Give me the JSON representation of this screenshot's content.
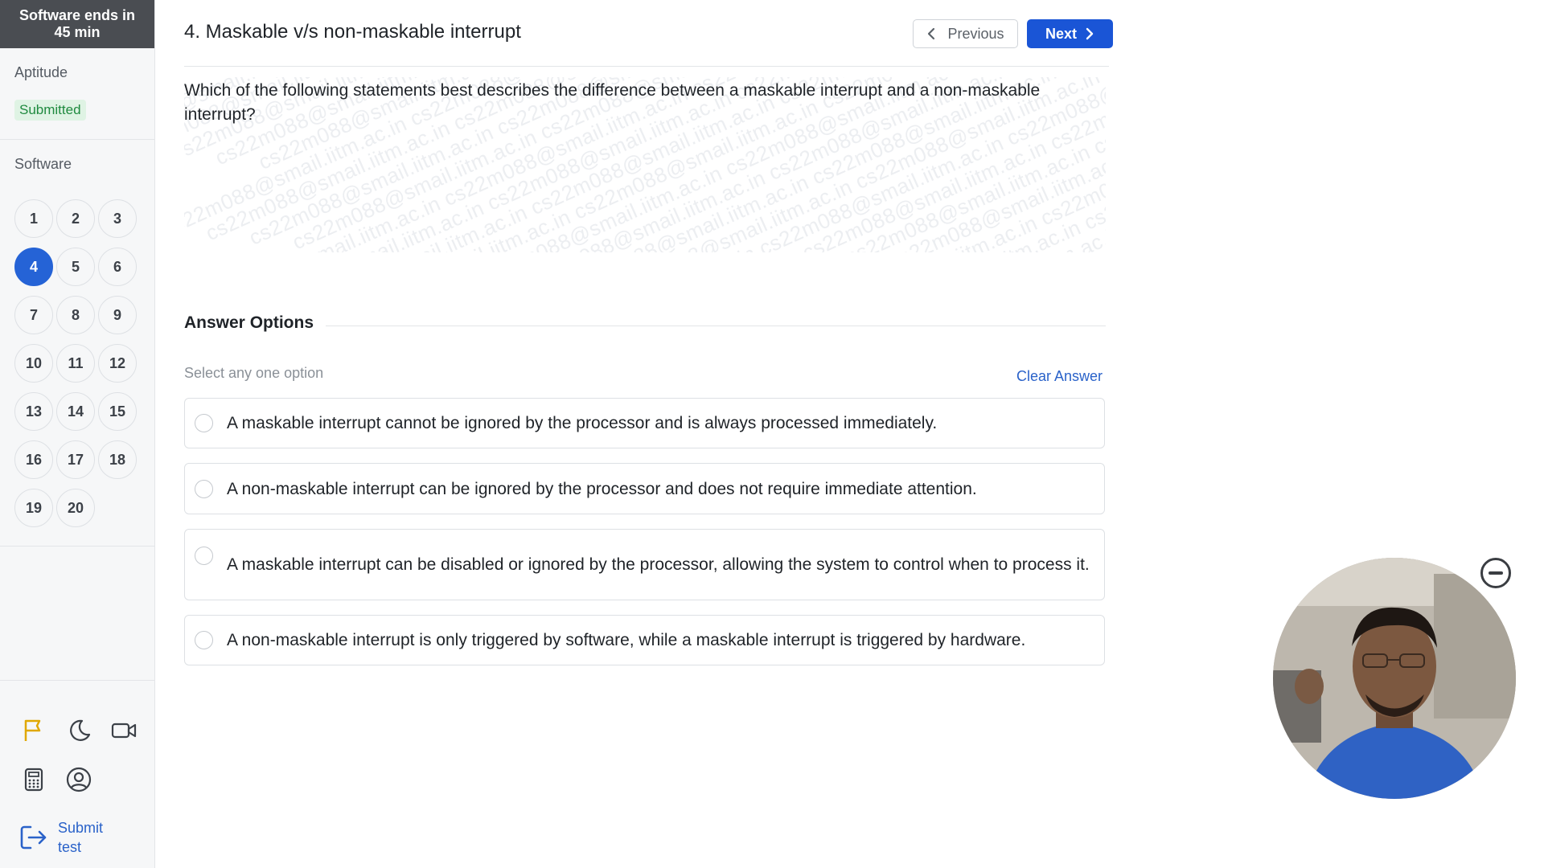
{
  "sidebar": {
    "timer": {
      "line1": "Software ends in",
      "line2": "45 min"
    },
    "sections": [
      {
        "title": "Aptitude",
        "status": "Submitted"
      },
      {
        "title": "Software"
      }
    ],
    "questions": [
      "1",
      "2",
      "3",
      "4",
      "5",
      "6",
      "7",
      "8",
      "9",
      "10",
      "11",
      "12",
      "13",
      "14",
      "15",
      "16",
      "17",
      "18",
      "19",
      "20"
    ],
    "active_question": "4",
    "tools": [
      "flag-icon",
      "moon-icon",
      "video-camera-icon",
      "calculator-icon",
      "user-circle-icon"
    ],
    "submit": {
      "line1": "Submit",
      "line2": "test"
    }
  },
  "header": {
    "title": "4. Maskable v/s non-maskable interrupt",
    "prev_label": "Previous",
    "next_label": "Next"
  },
  "question": {
    "text": "Which of the following statements best describes the difference between a maskable interrupt and a non-maskable interrupt?",
    "watermark": "cs22m088@smail.iitm.ac.in"
  },
  "answers": {
    "title": "Answer Options",
    "hint": "Select any one option",
    "clear_label": "Clear Answer",
    "options": [
      "A maskable interrupt cannot be ignored by the processor and is always processed immediately.",
      "A non-maskable interrupt can be ignored by the processor and does not require immediate attention.",
      "A maskable interrupt can be disabled or ignored by the processor, allowing the system to control when to process it.",
      "A non-maskable interrupt is only triggered by software, while a maskable interrupt is triggered by hardware."
    ]
  },
  "colors": {
    "accent": "#1a55d6",
    "active_question": "#2563d6",
    "submitted": "#1f8a3f",
    "flag": "#e0a800"
  }
}
